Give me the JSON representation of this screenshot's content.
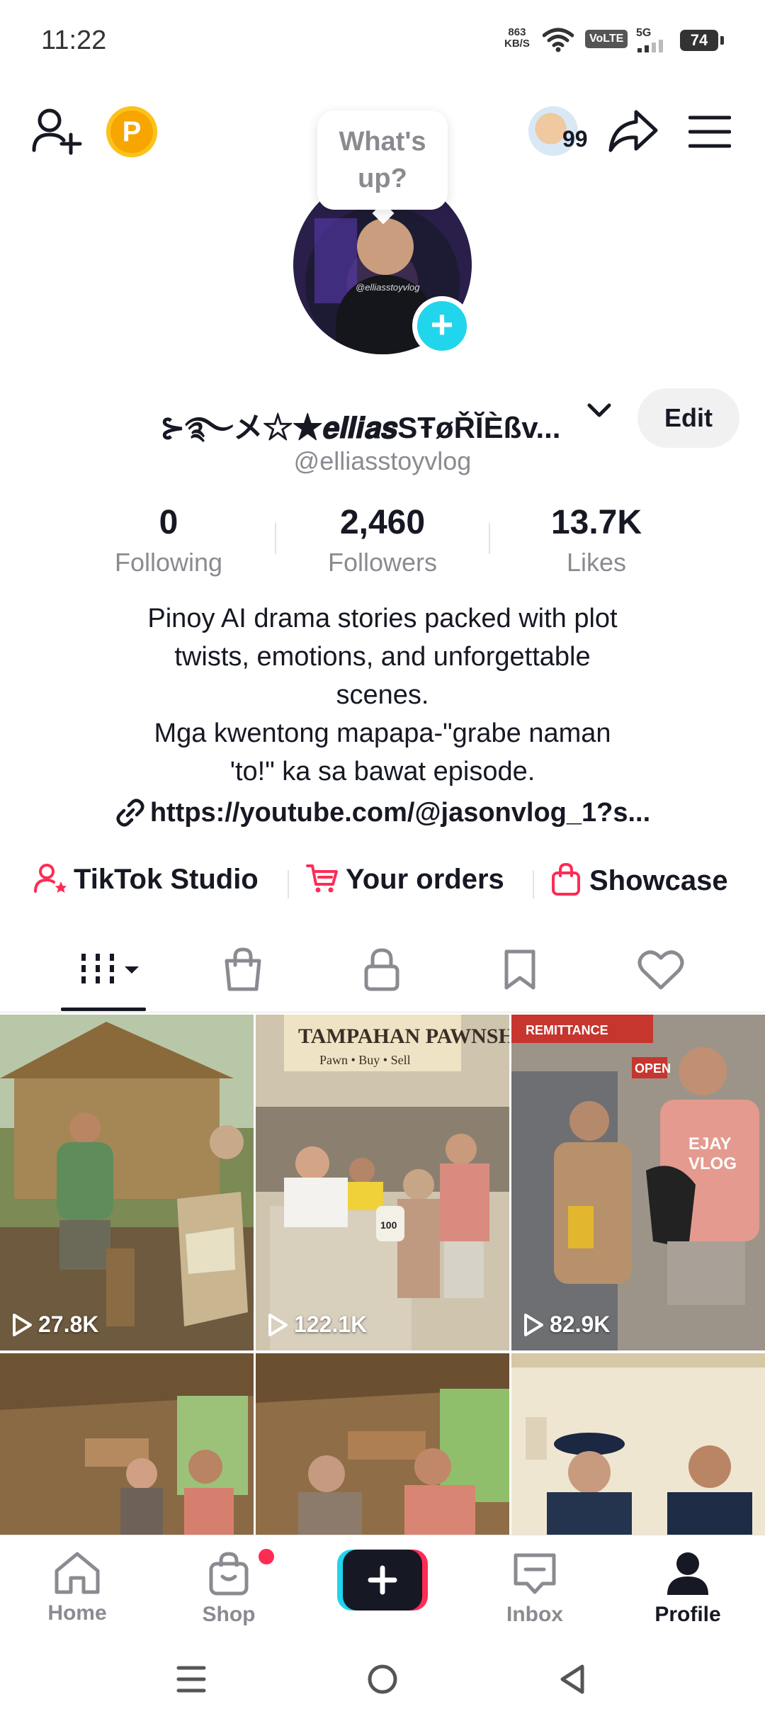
{
  "status_bar": {
    "time": "11:22",
    "net_speed_value": "863",
    "net_speed_unit": "KB/S",
    "volte": "VoLTE",
    "signal": "5G",
    "battery": "74"
  },
  "bubble": {
    "line1": "What's",
    "line2": "up?"
  },
  "avatar_watermark": "@elliasstoyvlog",
  "friends_count": "99",
  "profile": {
    "display_name": "⊱࿐メ☆★𝒆𝒍𝒍𝒊𝒂𝒔SŦøŘĬÈßv...",
    "edit_label": "Edit",
    "handle": "@elliasstoyvlog",
    "coin_letter": "P"
  },
  "stats": [
    {
      "value": "0",
      "label": "Following"
    },
    {
      "value": "2,460",
      "label": "Followers"
    },
    {
      "value": "13.7K",
      "label": "Likes"
    }
  ],
  "bio": {
    "line1": "Pinoy AI drama stories packed with plot",
    "line2": "twists, emotions, and unforgettable",
    "line3": "scenes.",
    "line4": "Mga kwentong mapapa-\"grabe naman",
    "line5": "'to!\" ka sa bawat episode.",
    "link": "https://youtube.com/@jasonvlog_1?s..."
  },
  "tools": {
    "studio": "TikTok Studio",
    "orders": "Your orders",
    "showcase": "Showcase"
  },
  "videos": [
    {
      "views": "27.8K"
    },
    {
      "views": "122.1K"
    },
    {
      "views": "82.9K"
    },
    {
      "views": ""
    },
    {
      "views": ""
    },
    {
      "views": ""
    }
  ],
  "thumb_text": {
    "pawnshop_sign": "TAMPAHAN PAWNSHOP",
    "pawnshop_sub": "Pawn • Buy • Sell",
    "remittance": "REMITTANCE",
    "open": "OPEN",
    "ejay": "EJAY",
    "vlog": "VLOG",
    "money_bag": "100"
  },
  "nav": {
    "home": "Home",
    "shop": "Shop",
    "inbox": "Inbox",
    "profile": "Profile"
  },
  "colors": {
    "accent_pink": "#fe2c55",
    "cyan": "#20d5ec",
    "coin": "#f7a600"
  }
}
